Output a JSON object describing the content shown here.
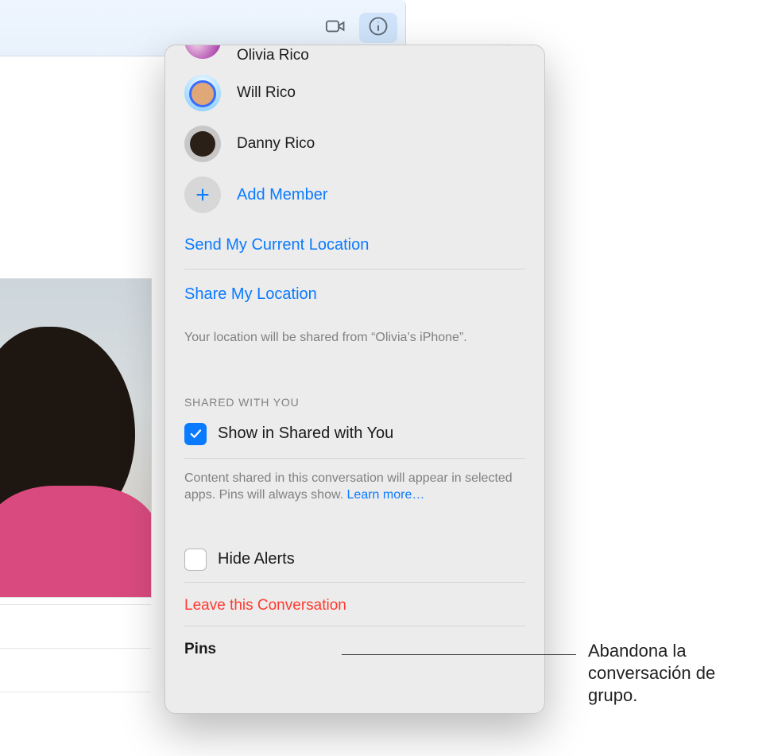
{
  "toolbar": {
    "video_icon": "video-icon",
    "info_icon": "info-icon"
  },
  "members": [
    {
      "name": "Olivia Rico",
      "cut": true,
      "avatar": "av-olivia"
    },
    {
      "name": "Will Rico",
      "cut": false,
      "avatar": "av-will"
    },
    {
      "name": "Danny Rico",
      "cut": false,
      "avatar": "av-danny"
    }
  ],
  "add_member_label": "Add Member",
  "send_location_label": "Send My Current Location",
  "share_location_label": "Share My Location",
  "share_caption": "Your location will be shared from “Olivia’s iPhone”.",
  "shared_section_label": "SHARED WITH YOU",
  "show_shared_label": "Show in Shared with You",
  "show_shared_checked": true,
  "shared_caption": "Content shared in this conversation will appear in selected apps. Pins will always show. ",
  "learn_more_label": "Learn more…",
  "hide_alerts_label": "Hide Alerts",
  "hide_alerts_checked": false,
  "leave_label": "Leave this Conversation",
  "pins_label": "Pins",
  "callout": "Abandona la conversación de grupo."
}
